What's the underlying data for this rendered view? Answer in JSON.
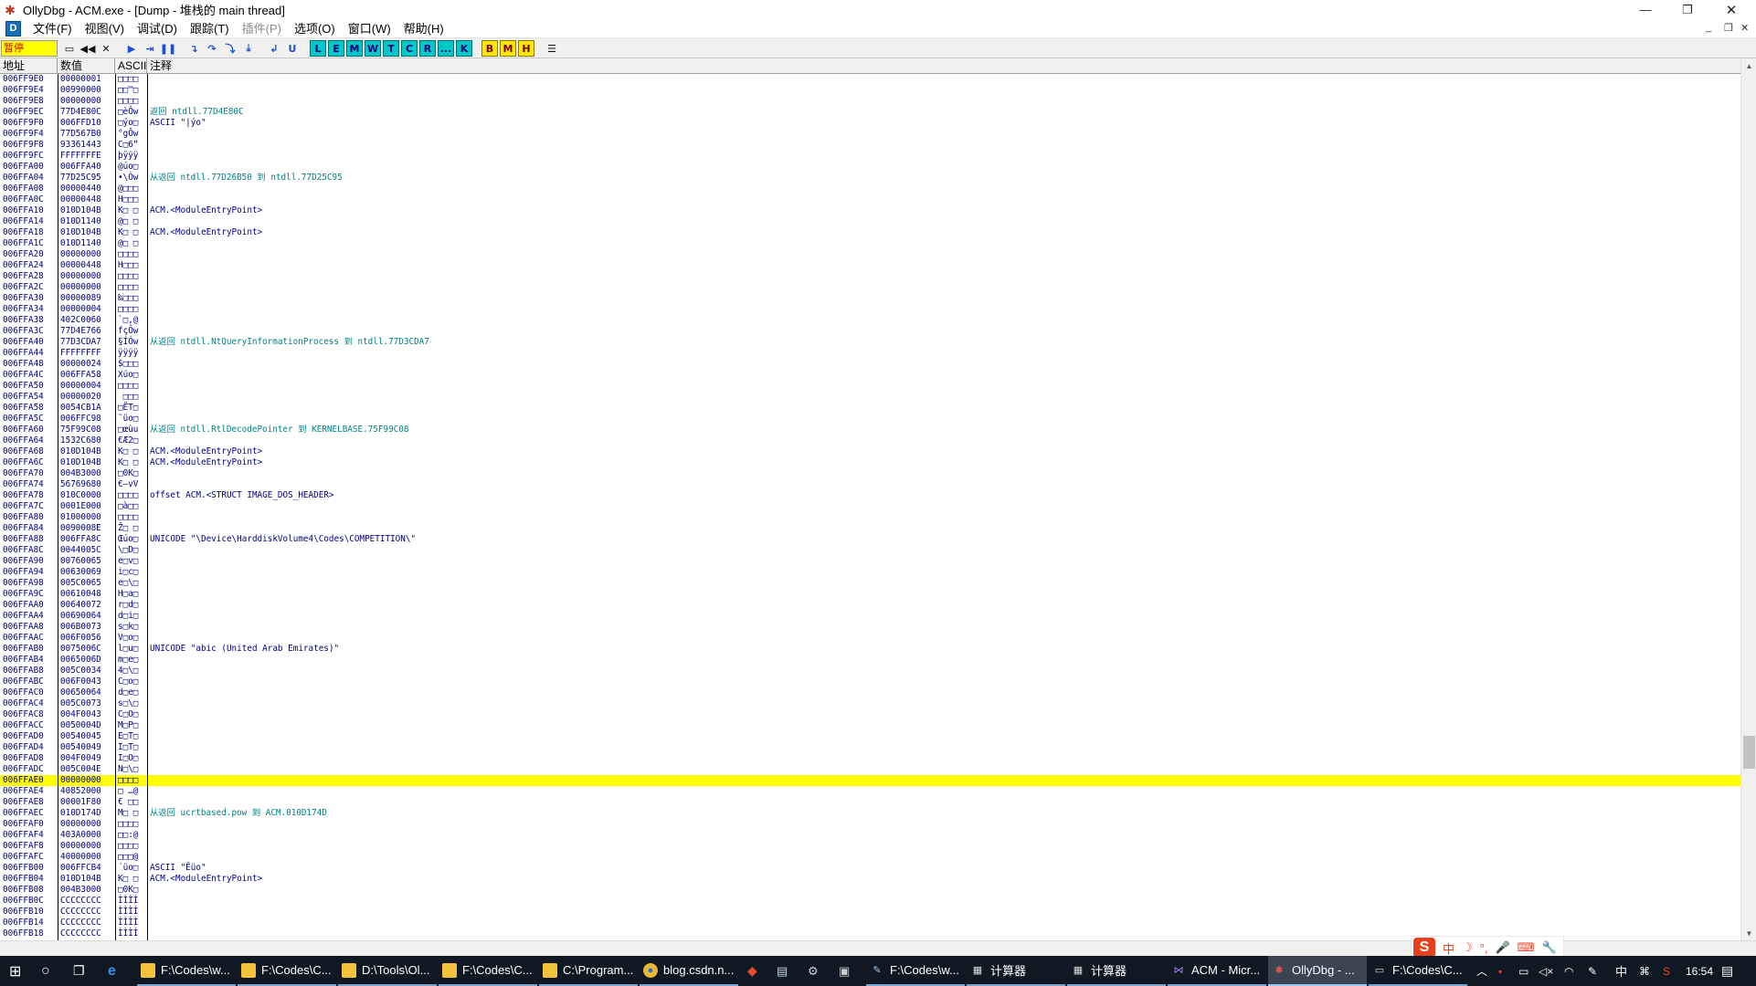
{
  "window": {
    "title": "OllyDbg - ACM.exe - [Dump - 堆栈的 main thread]",
    "app_icon": "bug-icon",
    "controls": [
      "minimize-icon",
      "restore-icon",
      "close-icon"
    ]
  },
  "menu": {
    "items": [
      {
        "label": "文件(F)",
        "enabled": true
      },
      {
        "label": "视图(V)",
        "enabled": true
      },
      {
        "label": "调试(D)",
        "enabled": true
      },
      {
        "label": "跟踪(T)",
        "enabled": true
      },
      {
        "label": "插件(P)",
        "enabled": false
      },
      {
        "label": "选项(O)",
        "enabled": true
      },
      {
        "label": "窗口(W)",
        "enabled": true
      },
      {
        "label": "帮助(H)",
        "enabled": true
      }
    ],
    "mdi_controls": [
      "_",
      "❐",
      "✕"
    ]
  },
  "toolbar": {
    "status": "暂停",
    "letters": [
      "L",
      "E",
      "M",
      "W",
      "T",
      "C",
      "R",
      "...",
      "K"
    ],
    "yellow_letters": [
      "B",
      "M",
      "H"
    ],
    "colors": {
      "status_bg": "#ffff00",
      "letter_bg": "#00c8c8",
      "yellow_bg": "#ffe600"
    }
  },
  "columns": {
    "address": "地址",
    "value": "数值",
    "ascii": "ASCII",
    "comment": "注释"
  },
  "rows": [
    {
      "a": "006FF9E0",
      "v": "00000001",
      "s": "□□□□",
      "c": ""
    },
    {
      "a": "006FF9E4",
      "v": "00990000",
      "s": "□□™□",
      "c": ""
    },
    {
      "a": "006FF9E8",
      "v": "00000000",
      "s": "□□□□",
      "c": ""
    },
    {
      "a": "006FF9EC",
      "v": "77D4E80C",
      "s": "□èÔw",
      "c": "返回 ntdll.77D4E80C",
      "ret": true
    },
    {
      "a": "006FF9F0",
      "v": "006FFD10",
      "s": "□ýo□",
      "c": "ASCII \"|ýo\""
    },
    {
      "a": "006FF9F4",
      "v": "77D567B0",
      "s": "°gÕw",
      "c": ""
    },
    {
      "a": "006FF9F8",
      "v": "93361443",
      "s": "C□6“",
      "c": ""
    },
    {
      "a": "006FF9FC",
      "v": "FFFFFFFE",
      "s": "þÿÿÿ",
      "c": ""
    },
    {
      "a": "006FFA00",
      "v": "006FFA40",
      "s": "@úo□",
      "c": ""
    },
    {
      "a": "006FFA04",
      "v": "77D25C95",
      "s": "•\\Òw",
      "c": "从返回 ntdll.77D26B50 到 ntdll.77D25C95",
      "ret": true
    },
    {
      "a": "006FFA08",
      "v": "00000440",
      "s": "@□□□",
      "c": ""
    },
    {
      "a": "006FFA0C",
      "v": "00000448",
      "s": "H□□□",
      "c": ""
    },
    {
      "a": "006FFA10",
      "v": "010D104B",
      "s": "K□ □",
      "c": "ACM.<ModuleEntryPoint>"
    },
    {
      "a": "006FFA14",
      "v": "010D1140",
      "s": "@□ □",
      "c": ""
    },
    {
      "a": "006FFA18",
      "v": "010D104B",
      "s": "K□ □",
      "c": "ACM.<ModuleEntryPoint>"
    },
    {
      "a": "006FFA1C",
      "v": "010D1140",
      "s": "@□ □",
      "c": ""
    },
    {
      "a": "006FFA20",
      "v": "00000000",
      "s": "□□□□",
      "c": ""
    },
    {
      "a": "006FFA24",
      "v": "00000448",
      "s": "H□□□",
      "c": ""
    },
    {
      "a": "006FFA28",
      "v": "00000000",
      "s": "□□□□",
      "c": ""
    },
    {
      "a": "006FFA2C",
      "v": "00000000",
      "s": "□□□□",
      "c": ""
    },
    {
      "a": "006FFA30",
      "v": "00000089",
      "s": "‰□□□",
      "c": ""
    },
    {
      "a": "006FFA34",
      "v": "00000004",
      "s": "□□□□",
      "c": ""
    },
    {
      "a": "006FFA38",
      "v": "402C0060",
      "s": "`□,@",
      "c": ""
    },
    {
      "a": "006FFA3C",
      "v": "77D4E766",
      "s": "fçÔw",
      "c": ""
    },
    {
      "a": "006FFA40",
      "v": "77D3CDA7",
      "s": "§ÍÓw",
      "c": "从返回 ntdll.NtQueryInformationProcess 到 ntdll.77D3CDA7",
      "ret": true
    },
    {
      "a": "006FFA44",
      "v": "FFFFFFFF",
      "s": "ÿÿÿÿ",
      "c": ""
    },
    {
      "a": "006FFA48",
      "v": "00000024",
      "s": "$□□□",
      "c": ""
    },
    {
      "a": "006FFA4C",
      "v": "006FFA58",
      "s": "Xúo□",
      "c": ""
    },
    {
      "a": "006FFA50",
      "v": "00000004",
      "s": "□□□□",
      "c": ""
    },
    {
      "a": "006FFA54",
      "v": "00000020",
      "s": " □□□",
      "c": ""
    },
    {
      "a": "006FFA58",
      "v": "0054CB1A",
      "s": "□ËT□",
      "c": ""
    },
    {
      "a": "006FFA5C",
      "v": "006FFC98",
      "s": "˜üo□",
      "c": ""
    },
    {
      "a": "006FFA60",
      "v": "75F99C08",
      "s": "□œùu",
      "c": "从返回 ntdll.RtlDecodePointer 到 KERNELBASE.75F99C08",
      "ret": true
    },
    {
      "a": "006FFA64",
      "v": "1532C680",
      "s": "€Æ2□",
      "c": ""
    },
    {
      "a": "006FFA68",
      "v": "010D104B",
      "s": "K□ □",
      "c": "ACM.<ModuleEntryPoint>"
    },
    {
      "a": "006FFA6C",
      "v": "010D104B",
      "s": "K□ □",
      "c": "ACM.<ModuleEntryPoint>"
    },
    {
      "a": "006FFA70",
      "v": "004B3000",
      "s": "□0K□",
      "c": ""
    },
    {
      "a": "006FFA74",
      "v": "56769680",
      "s": "€–vV",
      "c": ""
    },
    {
      "a": "006FFA78",
      "v": "010C0000",
      "s": "□□□□",
      "c": "offset ACM.<STRUCT IMAGE_DOS_HEADER>"
    },
    {
      "a": "006FFA7C",
      "v": "0001E000",
      "s": "□à□□",
      "c": ""
    },
    {
      "a": "006FFA80",
      "v": "01000000",
      "s": "□□□□",
      "c": ""
    },
    {
      "a": "006FFA84",
      "v": "0090008E",
      "s": "Ž□ □",
      "c": ""
    },
    {
      "a": "006FFA88",
      "v": "006FFA8C",
      "s": "Œúo□",
      "c": "UNICODE \"\\Device\\HarddiskVolume4\\Codes\\COMPETITION\\\""
    },
    {
      "a": "006FFA8C",
      "v": "0044005C",
      "s": "\\□D□",
      "c": ""
    },
    {
      "a": "006FFA90",
      "v": "00760065",
      "s": "e□v□",
      "c": ""
    },
    {
      "a": "006FFA94",
      "v": "00630069",
      "s": "i□c□",
      "c": ""
    },
    {
      "a": "006FFA98",
      "v": "005C0065",
      "s": "e□\\□",
      "c": ""
    },
    {
      "a": "006FFA9C",
      "v": "00610048",
      "s": "H□a□",
      "c": ""
    },
    {
      "a": "006FFAA0",
      "v": "00640072",
      "s": "r□d□",
      "c": ""
    },
    {
      "a": "006FFAA4",
      "v": "00690064",
      "s": "d□i□",
      "c": ""
    },
    {
      "a": "006FFAA8",
      "v": "006B0073",
      "s": "s□k□",
      "c": ""
    },
    {
      "a": "006FFAAC",
      "v": "006F0056",
      "s": "V□o□",
      "c": ""
    },
    {
      "a": "006FFAB0",
      "v": "0075006C",
      "s": "l□u□",
      "c": "UNICODE \"abic (United Arab Emirates)\""
    },
    {
      "a": "006FFAB4",
      "v": "0065006D",
      "s": "m□e□",
      "c": ""
    },
    {
      "a": "006FFAB8",
      "v": "005C0034",
      "s": "4□\\□",
      "c": ""
    },
    {
      "a": "006FFABC",
      "v": "006F0043",
      "s": "C□o□",
      "c": ""
    },
    {
      "a": "006FFAC0",
      "v": "00650064",
      "s": "d□e□",
      "c": ""
    },
    {
      "a": "006FFAC4",
      "v": "005C0073",
      "s": "s□\\□",
      "c": ""
    },
    {
      "a": "006FFAC8",
      "v": "004F0043",
      "s": "C□O□",
      "c": ""
    },
    {
      "a": "006FFACC",
      "v": "0050004D",
      "s": "M□P□",
      "c": ""
    },
    {
      "a": "006FFAD0",
      "v": "00540045",
      "s": "E□T□",
      "c": ""
    },
    {
      "a": "006FFAD4",
      "v": "00540049",
      "s": "I□T□",
      "c": ""
    },
    {
      "a": "006FFAD8",
      "v": "004F0049",
      "s": "I□O□",
      "c": ""
    },
    {
      "a": "006FFADC",
      "v": "005C004E",
      "s": "N□\\□",
      "c": ""
    },
    {
      "a": "006FFAE0",
      "v": "00000000",
      "s": "□□□□",
      "c": "",
      "hl": true
    },
    {
      "a": "006FFAE4",
      "v": "40852000",
      "s": "□ …@",
      "c": ""
    },
    {
      "a": "006FFAE8",
      "v": "00001F80",
      "s": "€ □□",
      "c": ""
    },
    {
      "a": "006FFAEC",
      "v": "010D174D",
      "s": "M□ □",
      "c": "从返回 ucrtbased.pow 到 ACM.010D174D",
      "ret": true
    },
    {
      "a": "006FFAF0",
      "v": "00000000",
      "s": "□□□□",
      "c": ""
    },
    {
      "a": "006FFAF4",
      "v": "403A0000",
      "s": "□□:@",
      "c": ""
    },
    {
      "a": "006FFAF8",
      "v": "00000000",
      "s": "□□□□",
      "c": ""
    },
    {
      "a": "006FFAFC",
      "v": "40000000",
      "s": "□□□@",
      "c": ""
    },
    {
      "a": "006FFB00",
      "v": "006FFCB4",
      "s": "´üo□",
      "c": "ASCII \"Ëüo\""
    },
    {
      "a": "006FFB04",
      "v": "010D104B",
      "s": "K□ □",
      "c": "ACM.<ModuleEntryPoint>"
    },
    {
      "a": "006FFB08",
      "v": "004B3000",
      "s": "□0K□",
      "c": ""
    },
    {
      "a": "006FFB0C",
      "v": "CCCCCCCC",
      "s": "ÌÌÌÌ",
      "c": ""
    },
    {
      "a": "006FFB10",
      "v": "CCCCCCCC",
      "s": "ÌÌÌÌ",
      "c": ""
    },
    {
      "a": "006FFB14",
      "v": "CCCCCCCC",
      "s": "ÌÌÌÌ",
      "c": ""
    },
    {
      "a": "006FFB18",
      "v": "CCCCCCCC",
      "s": "ÌÌÌÌ",
      "c": ""
    }
  ],
  "ime": {
    "logo": "S",
    "items": [
      "中",
      "☽",
      "°,",
      "🎤",
      "⌨",
      "🔧"
    ]
  },
  "taskbar": {
    "tasks": [
      {
        "label": "F:\\Codes\\w...",
        "icon": "folder-icon"
      },
      {
        "label": "F:\\Codes\\C...",
        "icon": "folder-icon"
      },
      {
        "label": "D:\\Tools\\Ol...",
        "icon": "folder-icon"
      },
      {
        "label": "F:\\Codes\\C...",
        "icon": "folder-icon"
      },
      {
        "label": "C:\\Program...",
        "icon": "folder-icon"
      },
      {
        "label": "blog.csdn.n...",
        "icon": "chrome-icon"
      },
      {
        "label": "F:\\Codes\\w...",
        "icon": "notepad-icon"
      },
      {
        "label": "计算器",
        "icon": "calculator-icon"
      },
      {
        "label": "计算器",
        "icon": "calculator-icon"
      },
      {
        "label": "ACM - Micr...",
        "icon": "visual-studio-icon"
      },
      {
        "label": "OllyDbg - ...",
        "icon": "ollydbg-icon",
        "active": true
      },
      {
        "label": "F:\\Codes\\C...",
        "icon": "terminal-icon"
      }
    ],
    "tray": {
      "lang": "中",
      "time": "16:54"
    }
  }
}
